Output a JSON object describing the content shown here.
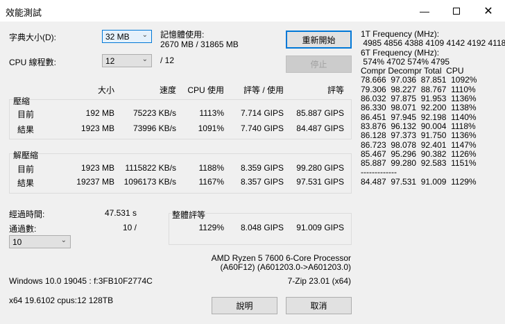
{
  "window": {
    "title": "效能測試"
  },
  "settings": {
    "dict_label": "字典大小(D):",
    "dict_value": "32 MB",
    "threads_label": "CPU 線程數:",
    "threads_value": "12",
    "threads_max": "/ 12",
    "mem_label": "記憶體使用:",
    "mem_value": "2670 MB / 31865 MB"
  },
  "buttons": {
    "restart": "重新開始",
    "stop": "停止",
    "help": "說明",
    "cancel": "取消"
  },
  "headers": [
    "大小",
    "速度",
    "CPU 使用",
    "評等 / 使用",
    "評等"
  ],
  "compress": {
    "label": "壓縮",
    "rows": [
      [
        "目前",
        "192 MB",
        "75223 KB/s",
        "1113%",
        "7.714 GIPS",
        "85.887 GIPS"
      ],
      [
        "結果",
        "1923 MB",
        "73996 KB/s",
        "1091%",
        "7.740 GIPS",
        "84.487 GIPS"
      ]
    ]
  },
  "decompress": {
    "label": "解壓縮",
    "rows": [
      [
        "目前",
        "1923 MB",
        "1115822 KB/s",
        "1188%",
        "8.359 GIPS",
        "99.280 GIPS"
      ],
      [
        "結果",
        "19237 MB",
        "1096173 KB/s",
        "1167%",
        "8.357 GIPS",
        "97.531 GIPS"
      ]
    ]
  },
  "elapsed": {
    "label": "經過時間:",
    "value": "47.531 s"
  },
  "passes": {
    "label": "通過數:",
    "value": "10 /",
    "select": "10"
  },
  "overall": {
    "label": "整體評等",
    "cpu": "1129%",
    "rating_usage": "8.048 GIPS",
    "rating": "91.009 GIPS"
  },
  "cpu": {
    "name": "AMD Ryzen 5 7600 6-Core Processor",
    "id": "(A60F12) (A601203.0->A601203.0)"
  },
  "sys": {
    "os": "Windows 10.0 19045 : f:3FB10F2774C",
    "version": "7-Zip 23.01 (x64)",
    "arch": "x64 19.6102 cpus:12 128TB"
  },
  "log": [
    "1T Frequency (MHz):",
    " 4985 4856 4388 4109 4142 4192 4118",
    "6T Frequency (MHz):",
    " 574% 4702 574% 4795",
    "Compr Decompr Total  CPU",
    "78.666  97.036  87.851  1092%",
    "79.306  98.227  88.767  1110%",
    "86.032  97.875  91.953  1136%",
    "86.330  98.071  92.200  1138%",
    "86.451  97.945  92.198  1140%",
    "83.876  96.132  90.004  1118%",
    "86.128  97.373  91.750  1136%",
    "86.723  98.078  92.401  1147%",
    "85.467  95.296  90.382  1126%",
    "85.887  99.280  92.583  1151%",
    "-------------",
    "84.487  97.531  91.009  1129%"
  ]
}
